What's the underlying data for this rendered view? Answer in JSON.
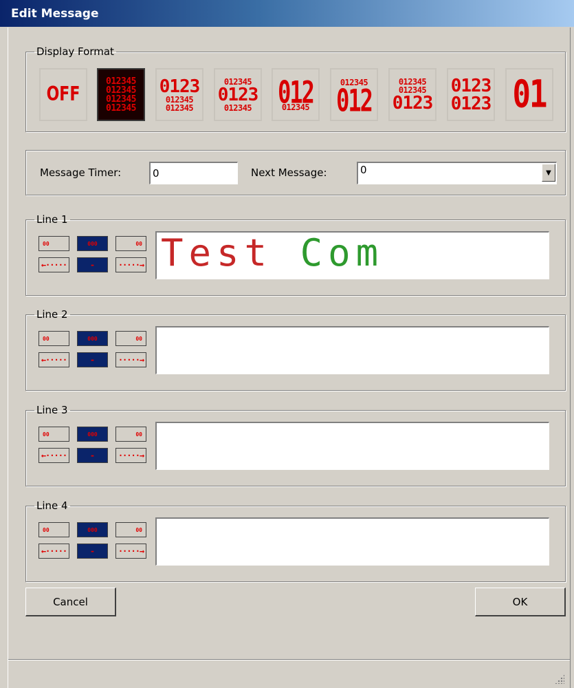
{
  "window": {
    "title": "Edit Message"
  },
  "display_format": {
    "legend": "Display Format",
    "options": [
      {
        "name": "off",
        "rows": [
          "OFF"
        ],
        "selected": false
      },
      {
        "name": "four-small-lines",
        "rows": [
          "012345",
          "012345",
          "012345",
          "012345"
        ],
        "selected": true
      },
      {
        "name": "one-medium-two-small",
        "rows": [
          "0123",
          "012345",
          "012345"
        ],
        "selected": false
      },
      {
        "name": "small-medium-small",
        "rows": [
          "012345",
          "0123",
          "012345"
        ],
        "selected": false
      },
      {
        "name": "large-small",
        "rows": [
          "012",
          "012345"
        ],
        "selected": false
      },
      {
        "name": "small-large",
        "rows": [
          "012345",
          "012"
        ],
        "selected": false
      },
      {
        "name": "two-small-medium",
        "rows": [
          "012345",
          "012345",
          "0123"
        ],
        "selected": false
      },
      {
        "name": "two-medium",
        "rows": [
          "0123",
          "0123"
        ],
        "selected": false
      },
      {
        "name": "extra-large",
        "rows": [
          "01"
        ],
        "selected": false
      }
    ]
  },
  "message_timer": {
    "label": "Message Timer:",
    "value": "0"
  },
  "next_message": {
    "label": "Next Message:",
    "value": "0"
  },
  "lines": [
    {
      "legend": "Line 1",
      "text_red": "Test",
      "text_green": "Com"
    },
    {
      "legend": "Line 2",
      "text_red": "",
      "text_green": ""
    },
    {
      "legend": "Line 3",
      "text_red": "",
      "text_green": ""
    },
    {
      "legend": "Line 4",
      "text_red": "",
      "text_green": ""
    }
  ],
  "line_controls": {
    "align_left": "00",
    "align_center": "000",
    "align_right": "00",
    "scroll_left": "←·····",
    "scroll_none": "-",
    "scroll_right": "·····→"
  },
  "buttons": {
    "cancel": "Cancel",
    "ok": "OK"
  },
  "colors": {
    "title_start": "#0a246a",
    "title_end": "#a6caf0",
    "led_red": "#c62828",
    "led_green": "#2e9a2e",
    "selected_dark": "#0a246a"
  }
}
